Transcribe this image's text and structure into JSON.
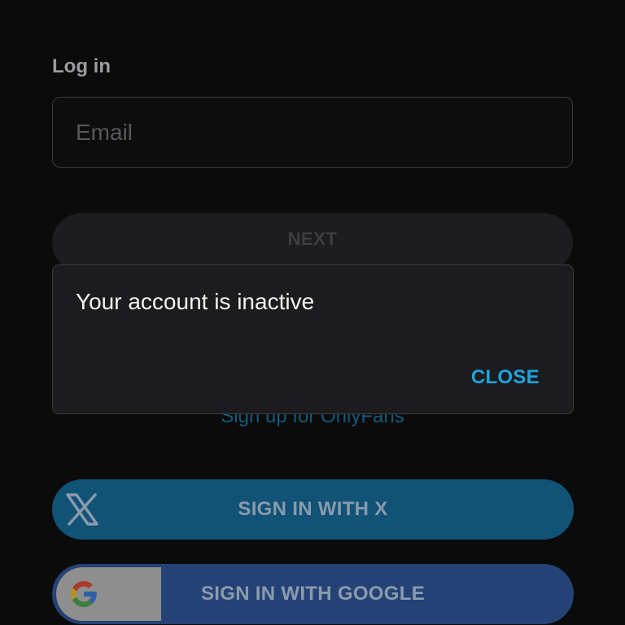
{
  "login": {
    "heading": "Log in",
    "email_placeholder": "Email",
    "email_value": "",
    "next_label": "NEXT",
    "signup_link": "Sign up for OnlyFans"
  },
  "dialog": {
    "message": "Your account is inactive",
    "close_label": "CLOSE"
  },
  "social": {
    "x_label": "SIGN IN WITH X",
    "google_label": "SIGN IN WITH GOOGLE",
    "x_icon": "x-logo-icon",
    "google_icon": "google-logo-icon"
  },
  "colors": {
    "background": "#0b0b0c",
    "accent": "#1ea3e0",
    "x_button": "#115277",
    "google_button": "#254276"
  }
}
